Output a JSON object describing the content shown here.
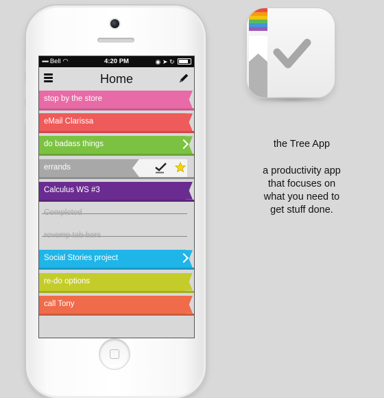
{
  "status_bar": {
    "carrier": "Bell",
    "time": "4:20 PM"
  },
  "nav": {
    "title": "Home",
    "menu_icon": "hamburger-menu-icon",
    "edit_icon": "pencil-icon"
  },
  "tasks": [
    {
      "label": "stop by the store",
      "color": "#e86aa6",
      "state": "active",
      "chevron": false
    },
    {
      "label": "eMail Clarissa",
      "color": "#ef5a5a",
      "state": "active",
      "chevron": false
    },
    {
      "label": "do badass things",
      "color": "#7cc242",
      "state": "active",
      "chevron": true
    },
    {
      "label": "errands",
      "color": "#a8a8a8",
      "state": "swiped",
      "chevron": false
    },
    {
      "label": "Calculus WS #3",
      "color": "#6a2c91",
      "state": "active",
      "chevron": false
    },
    {
      "label": "Completed",
      "color": "#d8d8d8",
      "state": "completed",
      "chevron": false
    },
    {
      "label": "revamp tab bars",
      "color": "#d8d8d8",
      "state": "completed",
      "chevron": false
    },
    {
      "label": "Social Stories project",
      "color": "#1fb5e8",
      "state": "active",
      "chevron": true
    },
    {
      "label": "re-do options",
      "color": "#c4cc2a",
      "state": "active",
      "chevron": false
    },
    {
      "label": "call Tony",
      "color": "#ef6b4a",
      "state": "active",
      "chevron": false
    }
  ],
  "swipe_actions": {
    "check_icon": "checkmark-icon",
    "star_icon": "star-icon",
    "star_color": "#f5d800"
  },
  "app_icon": {
    "icon": "checkmark-icon",
    "ribbon_colors": [
      "#e84c3d",
      "#f39c12",
      "#f1c40f",
      "#5cb85c",
      "#3a9ad9",
      "#9b59b6"
    ]
  },
  "description": {
    "title": "the Tree App",
    "line1": "a productivity app",
    "line2": "that focuses on",
    "line3": "what you need to",
    "line4": "get stuff done."
  }
}
